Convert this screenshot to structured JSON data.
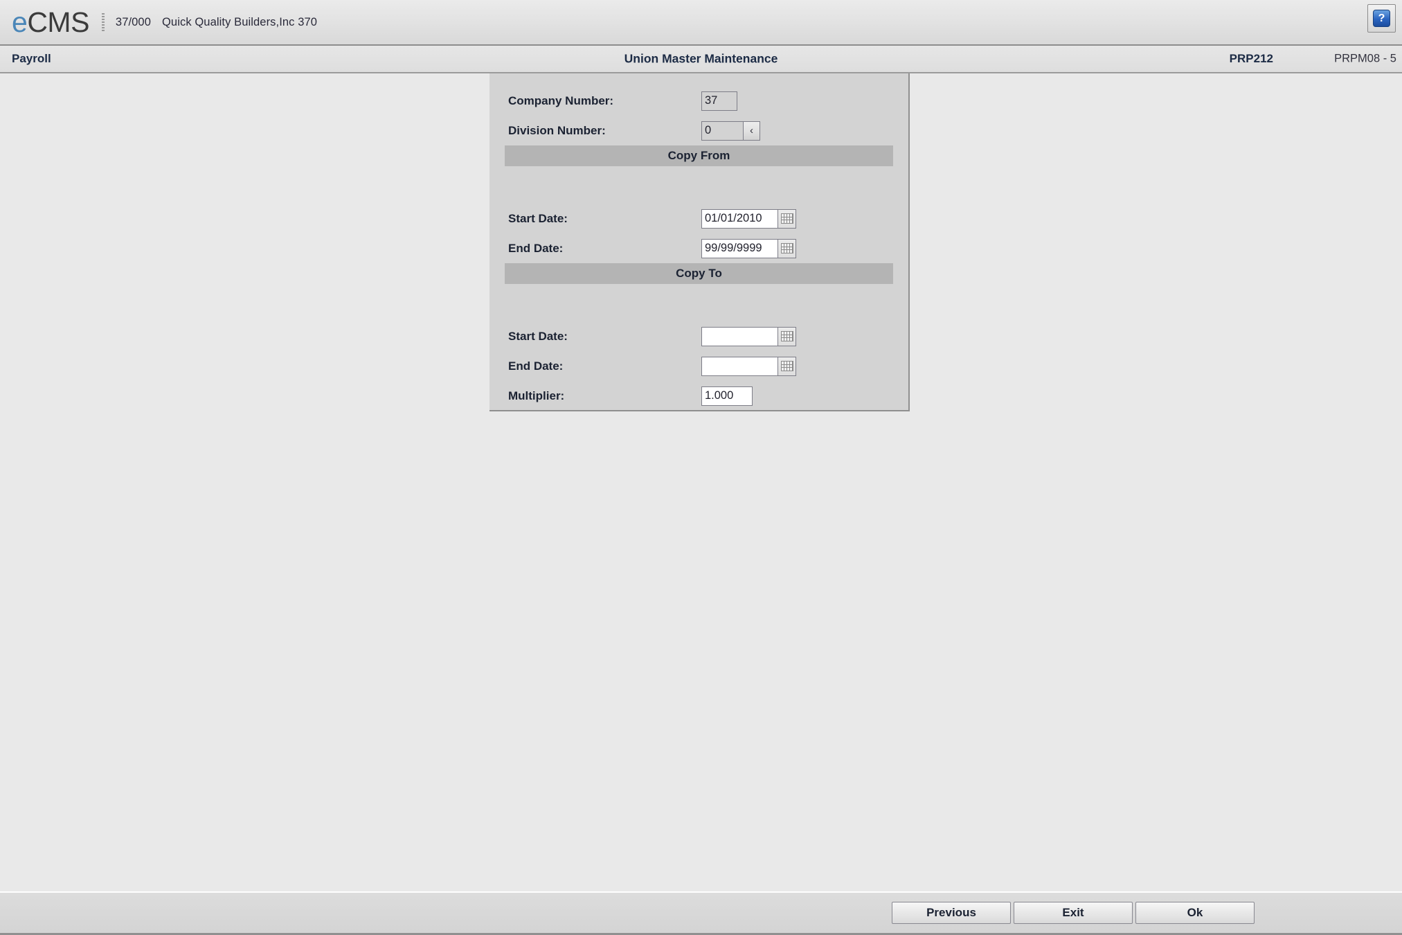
{
  "topbar": {
    "logo_e": "e",
    "logo_cms": "CMS",
    "company_code": "37/000",
    "company_name": "Quick Quality Builders,Inc 370",
    "help_glyph": "?",
    "help_icon_name": "help-icon"
  },
  "modbar": {
    "module": "Payroll",
    "title": "Union Master Maintenance",
    "program_id": "PRP212",
    "screen_id": "PRPM08 - 5"
  },
  "form": {
    "company_number": {
      "label": "Company Number:",
      "value": "37"
    },
    "division_number": {
      "label": "Division Number:",
      "value": "0",
      "spin_glyph": "‹"
    },
    "copy_from": {
      "band_label": "Copy From",
      "start_date": {
        "label": "Start Date:",
        "value": "01/01/2010",
        "placeholder": ""
      },
      "end_date": {
        "label": "End Date:",
        "value": "99/99/9999",
        "placeholder": ""
      }
    },
    "copy_to": {
      "band_label": "Copy To",
      "start_date": {
        "label": "Start Date:",
        "value": "",
        "placeholder": ""
      },
      "end_date": {
        "label": "End Date:",
        "value": "",
        "placeholder": ""
      },
      "multiplier": {
        "label": "Multiplier:",
        "value": "1.000",
        "placeholder": ""
      }
    }
  },
  "buttons": {
    "previous": "Previous",
    "exit": "Exit",
    "ok": "Ok"
  }
}
